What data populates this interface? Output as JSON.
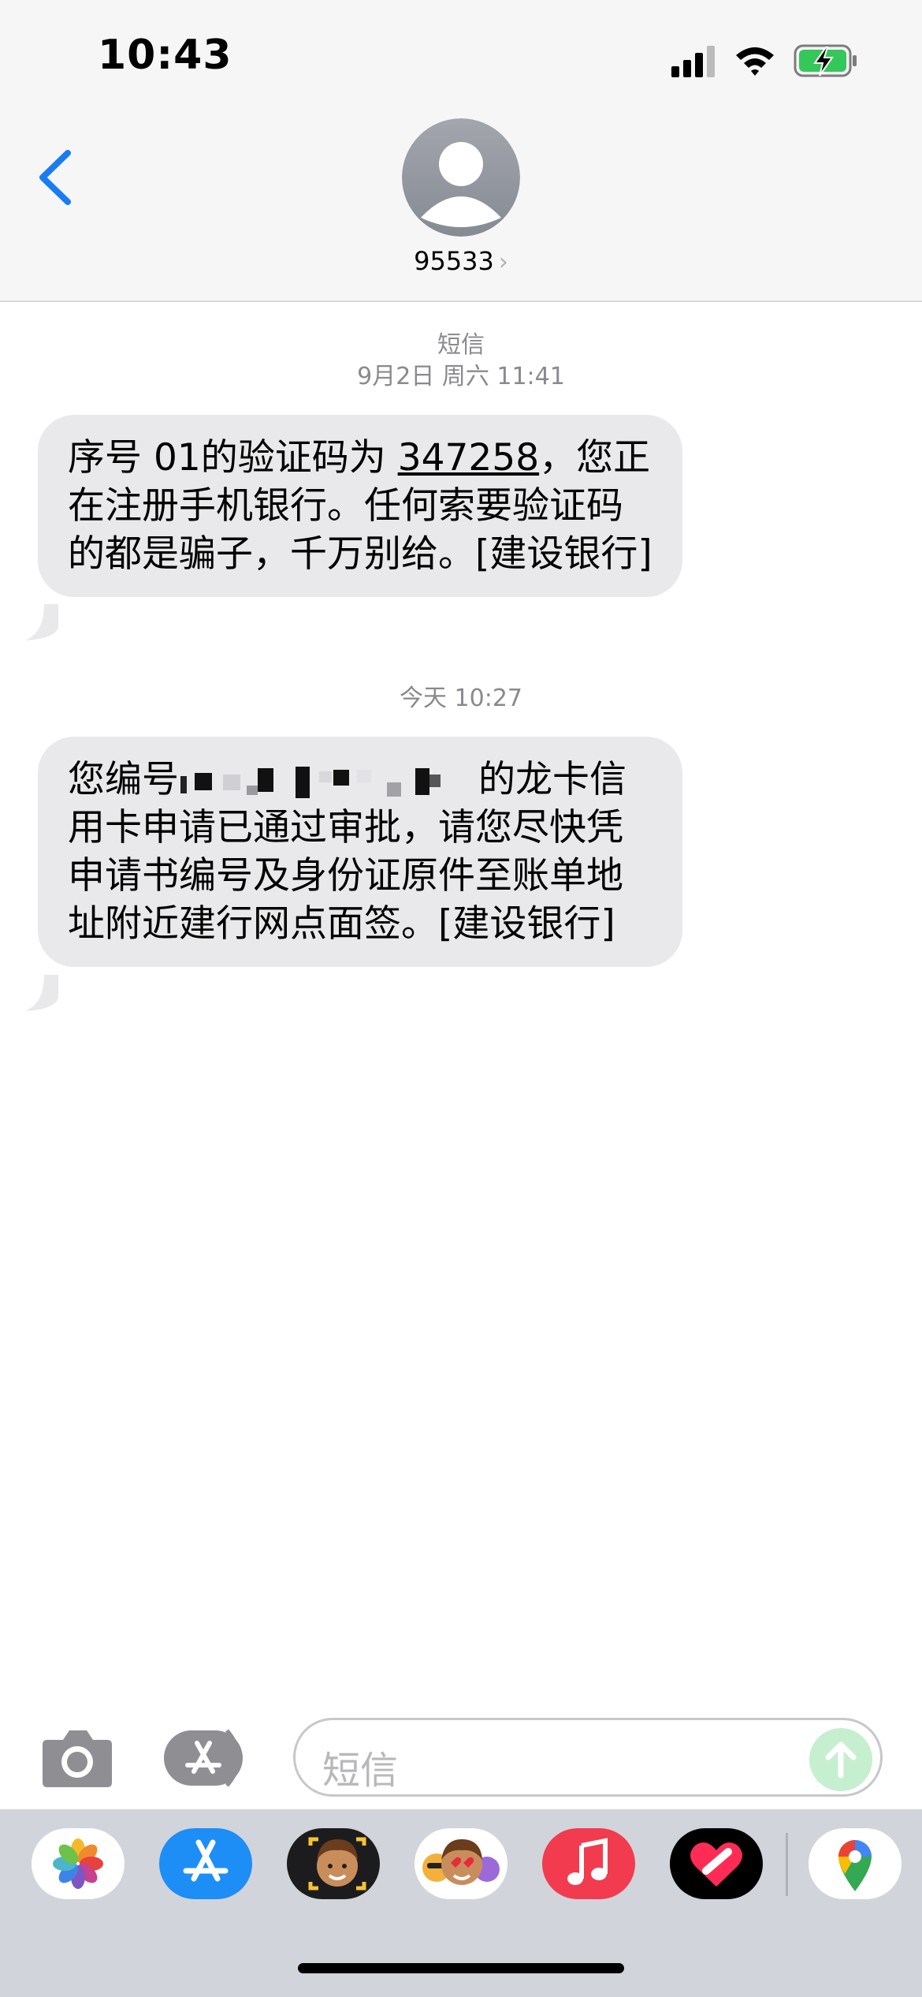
{
  "status_bar": {
    "time": "10:43"
  },
  "header": {
    "contact": "95533",
    "chevron": "›"
  },
  "messages": [
    {
      "label": "短信",
      "timestamp": "9月2日 周六 11:41",
      "text_before": "序号 01的验证码为 ",
      "code": "347258",
      "text_after": "，您正在注册手机银行。任何索要验证码的都是骗子，千万别给。[建设银行]"
    },
    {
      "timestamp": "今天 10:27",
      "text_before": "您编号",
      "text_after": "的龙卡信用卡申请已通过审批，请您尽快凭申请书编号及身份证原件至账单地址附近建行网点面签。[建设银行]"
    }
  ],
  "input": {
    "placeholder": "短信"
  },
  "app_strip": {
    "apps": [
      "photos-icon",
      "app-store-icon",
      "memoji-stickers-icon",
      "animoji-icon",
      "music-icon",
      "fitness-heart-icon",
      "google-maps-icon"
    ]
  },
  "colors": {
    "accent": "#1a7cf3",
    "bubble": "#e9e9eb",
    "send_disabled": "#c6efd0",
    "battery": "#34c759"
  }
}
